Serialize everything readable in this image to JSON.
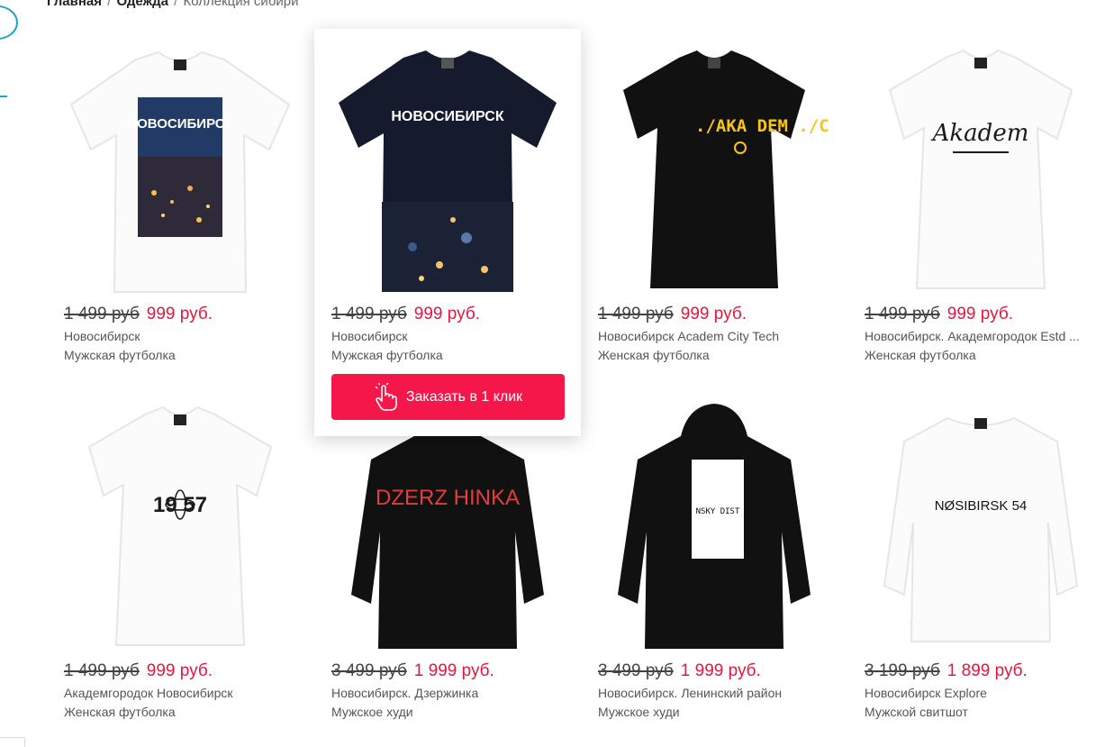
{
  "breadcrumb": {
    "home": "Главная",
    "sep1": "/",
    "section": "Одежда",
    "sep2": "/",
    "current": "Коллекция сибири"
  },
  "colors": {
    "accent": "#f5164a",
    "price_new": "#e3173d",
    "deco": "#1aa7c4"
  },
  "products": [
    {
      "old_price": "1 499 руб",
      "new_price": "999 руб.",
      "title": "Новосибирск",
      "subtitle": "Мужская футболка",
      "print": "НОВОСИБИРСК"
    },
    {
      "old_price": "1 499 руб",
      "new_price": "999 руб.",
      "title": "Новосибирск",
      "subtitle": "Мужская футболка",
      "print": "НОВОСИБИРСК",
      "button": "Заказать в 1 клик"
    },
    {
      "old_price": "1 499 руб",
      "new_price": "999 руб.",
      "title": "Новосибирск Academ City Tech",
      "subtitle": "Женская футболка",
      "print": "./AKA DEM ./CITY"
    },
    {
      "old_price": "1 499 руб",
      "new_price": "999 руб.",
      "title": "Новосибирск. Академгородок Estd ...",
      "subtitle": "Женская футболка",
      "print": "Akadem"
    },
    {
      "old_price": "1 499 руб",
      "new_price": "999 руб.",
      "title": "Академгородок Новосибирск",
      "subtitle": "Женская футболка",
      "print": "19 57"
    },
    {
      "old_price": "3 499 руб",
      "new_price": "1 999 руб.",
      "title": "Новосибирск. Дзержинка",
      "subtitle": "Мужское худи",
      "print": "DZERZ HINKA"
    },
    {
      "old_price": "3 499 руб",
      "new_price": "1 999 руб.",
      "title": "Новосибирск. Ленинский район",
      "subtitle": "Мужское худи",
      "print": "LENI NSKY DIST RICT"
    },
    {
      "old_price": "3 199 руб",
      "new_price": "1 899 руб.",
      "title": "Новосибирск Explore",
      "subtitle": "Мужской свитшот",
      "print": "NØSIBIRSK 54"
    }
  ]
}
